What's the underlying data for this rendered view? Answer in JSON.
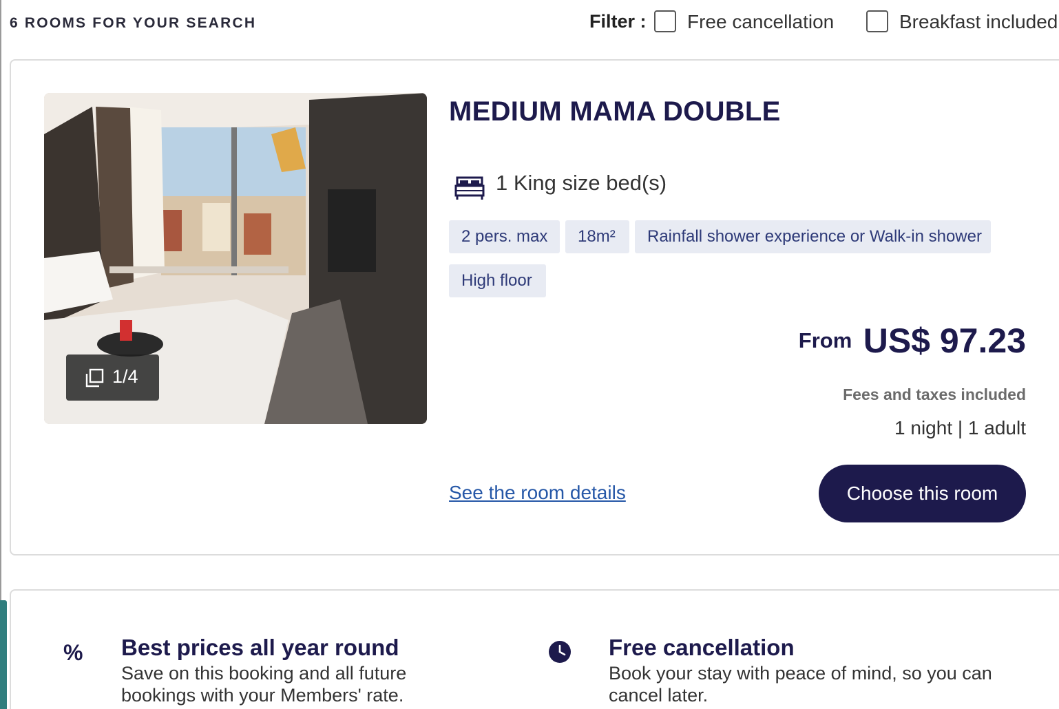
{
  "header": {
    "results_count": "6 ROOMS FOR YOUR SEARCH",
    "filter_label": "Filter :",
    "filters": [
      {
        "label": "Free cancellation",
        "checked": false
      },
      {
        "label": "Breakfast included",
        "checked": false
      }
    ]
  },
  "room": {
    "title": "MEDIUM MAMA DOUBLE",
    "photo_counter": "1/4",
    "bed": "1 King size bed(s)",
    "tags": [
      "2 pers. max",
      "18m²",
      "Rainfall shower experience or Walk-in shower",
      "High floor"
    ],
    "price_from_label": "From",
    "price": "US$ 97.23",
    "fees_note": "Fees and taxes included",
    "stay_summary": "1 night | 1 adult",
    "details_link": "See the room details",
    "choose_button": "Choose this room"
  },
  "benefits": [
    {
      "icon": "percent-icon",
      "title": "Best prices all year round",
      "description": "Save on this booking and all future bookings with your Members' rate."
    },
    {
      "icon": "clock-icon",
      "title": "Free cancellation",
      "description": "Book your stay with peace of mind, so you can cancel later."
    }
  ],
  "colors": {
    "brand_navy": "#1d1a4c",
    "tag_background": "#e8ebf3",
    "link_blue": "#2557a7"
  }
}
